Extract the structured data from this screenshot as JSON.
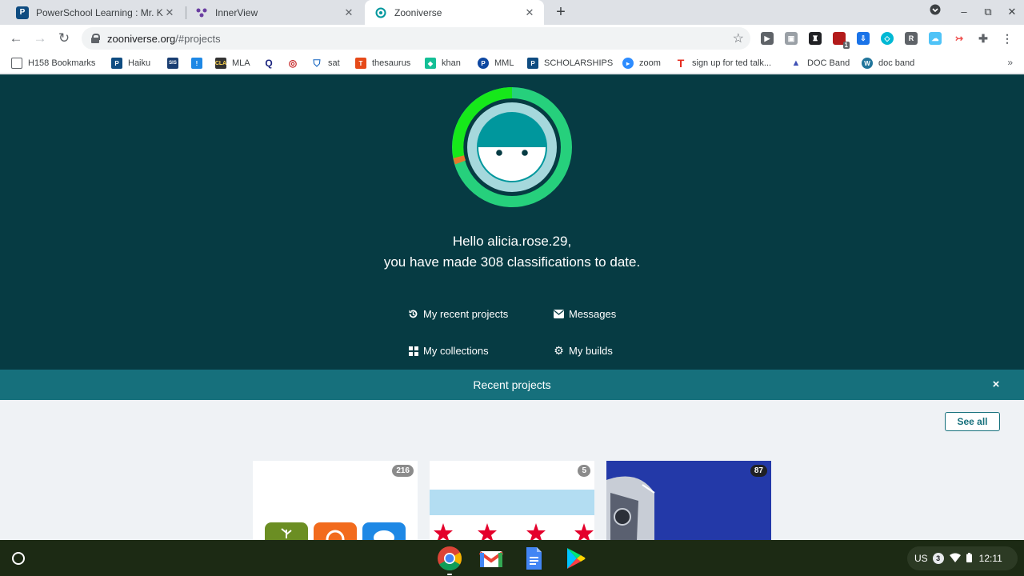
{
  "tabs": [
    {
      "title": "PowerSchool Learning : Mr. Kala",
      "icon": "powerschool-icon"
    },
    {
      "title": "InnerView",
      "icon": "innerview-icon"
    },
    {
      "title": "Zooniverse",
      "icon": "zooniverse-icon",
      "active": true
    }
  ],
  "address_bar": {
    "host": "zooniverse.org",
    "path": "/#projects"
  },
  "bookmarks": [
    {
      "label": "H158 Bookmarks"
    },
    {
      "label": "Haiku"
    },
    {
      "label": "SIS"
    },
    {
      "label": ""
    },
    {
      "label": "MLA"
    },
    {
      "label": ""
    },
    {
      "label": ""
    },
    {
      "label": "sat"
    },
    {
      "label": "thesaurus"
    },
    {
      "label": "khan"
    },
    {
      "label": "MML"
    },
    {
      "label": "SCHOLARSHIPS"
    },
    {
      "label": "zoom"
    },
    {
      "label": "sign up for ted talk..."
    },
    {
      "label": "DOC Band"
    },
    {
      "label": "doc band"
    }
  ],
  "hero": {
    "greeting_line1": "Hello alicia.rose.29,",
    "greeting_line2": "you have made 308 classifications to date.",
    "links": [
      {
        "label": "My recent projects",
        "icon": "history-icon"
      },
      {
        "label": "Messages",
        "icon": "envelope-icon"
      },
      {
        "label": "My collections",
        "icon": "grid-icon"
      },
      {
        "label": "My builds",
        "icon": "gear-icon"
      }
    ]
  },
  "recent": {
    "title": "Recent projects",
    "close_label": "×",
    "see_all_label": "See all",
    "cards": [
      {
        "count": "216"
      },
      {
        "count": "5"
      },
      {
        "count": "87"
      }
    ]
  },
  "extension_badge": "1",
  "tray": {
    "locale": "US",
    "notifications": "3",
    "time": "12:11"
  },
  "colors": {
    "hero_bg": "#063b43",
    "recent_bar": "#16707c",
    "content_bg": "#eff2f5",
    "avatar_ring": "#26d07c"
  }
}
